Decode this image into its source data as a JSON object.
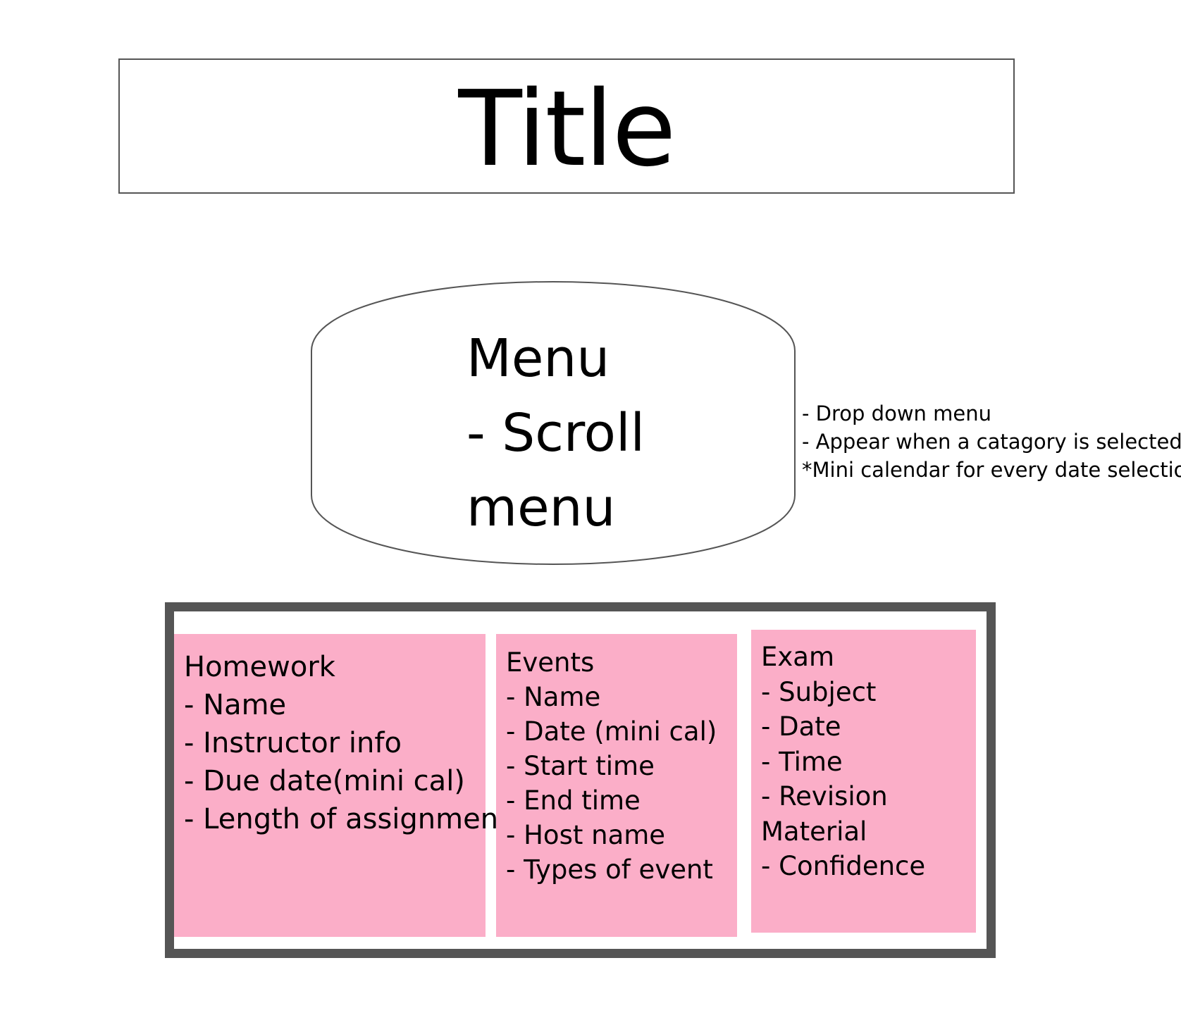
{
  "title": "Title",
  "menu": {
    "lines": [
      "Menu",
      "- Scroll",
      "menu"
    ]
  },
  "notes": [
    "- Drop down menu",
    "- Appear when a catagory is selected",
    "*Mini calendar for every date selection"
  ],
  "categories": {
    "homework": {
      "heading": "Homework",
      "items": [
        "- Name",
        "- Instructor info",
        "- Due date(mini cal)",
        "- Length of assignment"
      ]
    },
    "events": {
      "heading": "Events",
      "items": [
        "- Name",
        "- Date (mini cal)",
        "- Start time",
        "- End time",
        "- Host name",
        "- Types of event"
      ]
    },
    "exam": {
      "heading": "Exam",
      "items": [
        "- Subject",
        "- Date",
        "- Time",
        "- Revision",
        "Material",
        "- Confidence"
      ]
    }
  },
  "colors": {
    "card_fill": "#fbaec8",
    "border": "#555555"
  }
}
